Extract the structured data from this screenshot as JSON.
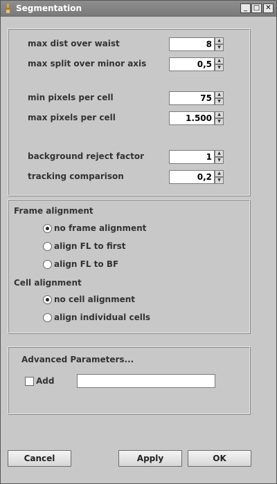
{
  "window": {
    "title": "Segmentation",
    "buttons": {
      "minimize": "_",
      "maximize": "□",
      "close": "✕"
    }
  },
  "parameters": [
    {
      "label": "max dist over waist",
      "value": "8"
    },
    {
      "label": "max split over minor axis",
      "value": "0,5"
    },
    {
      "label": "min pixels per cell",
      "value": "75"
    },
    {
      "label": "max pixels per cell",
      "value": "1.500"
    },
    {
      "label": "background reject factor",
      "value": "1"
    },
    {
      "label": "tracking comparison",
      "value": "0,2"
    }
  ],
  "frame_alignment": {
    "title": "Frame alignment",
    "options": [
      {
        "label": "no frame alignment",
        "selected": true
      },
      {
        "label": "align FL to first",
        "selected": false
      },
      {
        "label": "align FL to BF",
        "selected": false
      }
    ]
  },
  "cell_alignment": {
    "title": "Cell alignment",
    "options": [
      {
        "label": "no cell alignment",
        "selected": true
      },
      {
        "label": "align individual cells",
        "selected": false
      }
    ]
  },
  "advanced": {
    "title": "Advanced Parameters...",
    "add_label": "Add",
    "add_checked": false,
    "add_value": ""
  },
  "footer": {
    "cancel_label": "Cancel",
    "apply_label": "Apply",
    "ok_label": "OK"
  }
}
